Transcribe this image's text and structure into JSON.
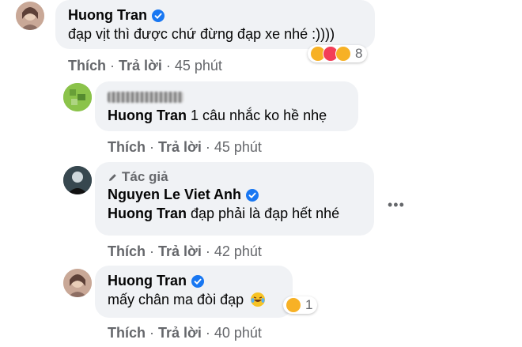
{
  "comments": [
    {
      "author": "Huong Tran",
      "verified": true,
      "text": "đạp vịt thì được chứ đừng đạp xe nhé :))))",
      "actions": {
        "like": "Thích",
        "reply": "Trả lời",
        "time": "45 phút"
      },
      "reactions": {
        "icons": [
          "haha-icon",
          "love-icon",
          "wow-icon"
        ],
        "count": "8"
      }
    },
    {
      "author": "",
      "author_blurred": true,
      "mention": "Huong Tran",
      "text": "1 câu nhắc ko hề nhẹ",
      "actions": {
        "like": "Thích",
        "reply": "Trả lời",
        "time": "45 phút"
      }
    },
    {
      "author_tag": "Tác giả",
      "author": "Nguyen Le Viet Anh",
      "verified": true,
      "mention": "Huong Tran",
      "text": "đạp phải là đạp hết nhé",
      "actions": {
        "like": "Thích",
        "reply": "Trả lời",
        "time": "42 phút"
      }
    },
    {
      "author": "Huong Tran",
      "verified": true,
      "text": "mấy chân ma đòi đạp",
      "emoji": "laughing-tears-emoji",
      "actions": {
        "like": "Thích",
        "reply": "Trả lời",
        "time": "40 phút"
      },
      "reactions": {
        "icons": [
          "wow-icon"
        ],
        "count": "1"
      }
    }
  ],
  "colors": {
    "bubble": "#f0f2f5",
    "meta": "#65676b",
    "verified": "#1877f2"
  }
}
